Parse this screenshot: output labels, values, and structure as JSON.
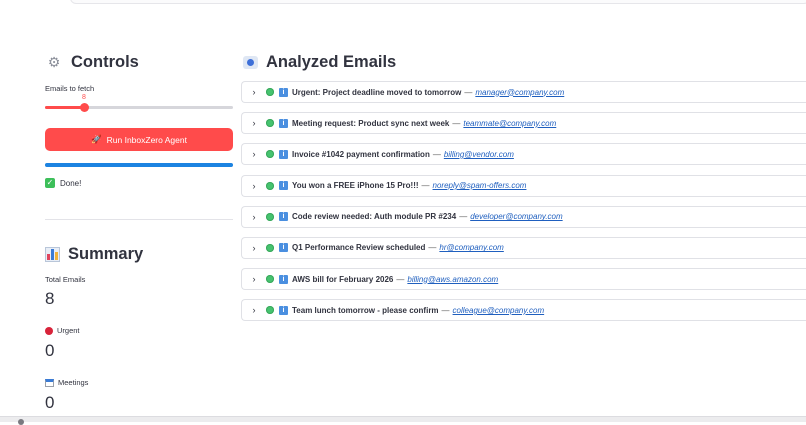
{
  "sidebar": {
    "controls_title": "Controls",
    "emails_to_fetch_label": "Emails to fetch",
    "emails_to_fetch_value": "8",
    "slider_fraction": 0.21,
    "run_button_label": "Run InboxZero Agent",
    "progress_fraction": 1.0,
    "done_label": "Done!",
    "summary_title": "Summary",
    "metrics": {
      "total_label": "Total Emails",
      "total_value": "8",
      "urgent_label": "Urgent",
      "urgent_value": "0",
      "meetings_label": "Meetings",
      "meetings_value": "0"
    }
  },
  "main": {
    "title": "Analyzed Emails",
    "emails": [
      {
        "subject": "Urgent: Project deadline moved to tomorrow",
        "sender": "manager@company.com"
      },
      {
        "subject": "Meeting request: Product sync next week",
        "sender": "teammate@company.com"
      },
      {
        "subject": "Invoice #1042 payment confirmation",
        "sender": "billing@vendor.com"
      },
      {
        "subject": "You won a FREE iPhone 15 Pro!!!",
        "sender": "noreply@spam-offers.com"
      },
      {
        "subject": "Code review needed: Auth module PR #234",
        "sender": "developer@company.com"
      },
      {
        "subject": "Q1 Performance Review scheduled",
        "sender": "hr@company.com"
      },
      {
        "subject": "AWS bill for February 2026",
        "sender": "billing@aws.amazon.com"
      },
      {
        "subject": "Team lunch tomorrow - please confirm",
        "sender": "colleague@company.com"
      }
    ],
    "separator": "—"
  },
  "colors": {
    "accent": "#ff4b4b",
    "progress": "#1c83e1",
    "status_green": "#46c36f",
    "link": "#1f5fbf"
  },
  "icons": {
    "controls": "gear-icon",
    "run": "rocket-icon",
    "done": "check-icon",
    "summary": "bar-chart-icon",
    "urgent": "red-circle-icon",
    "meetings": "calendar-icon",
    "analyzed": "blue-circle-icon",
    "expand": "chevron-right-icon",
    "status": "green-circle-icon",
    "info": "info-icon"
  }
}
